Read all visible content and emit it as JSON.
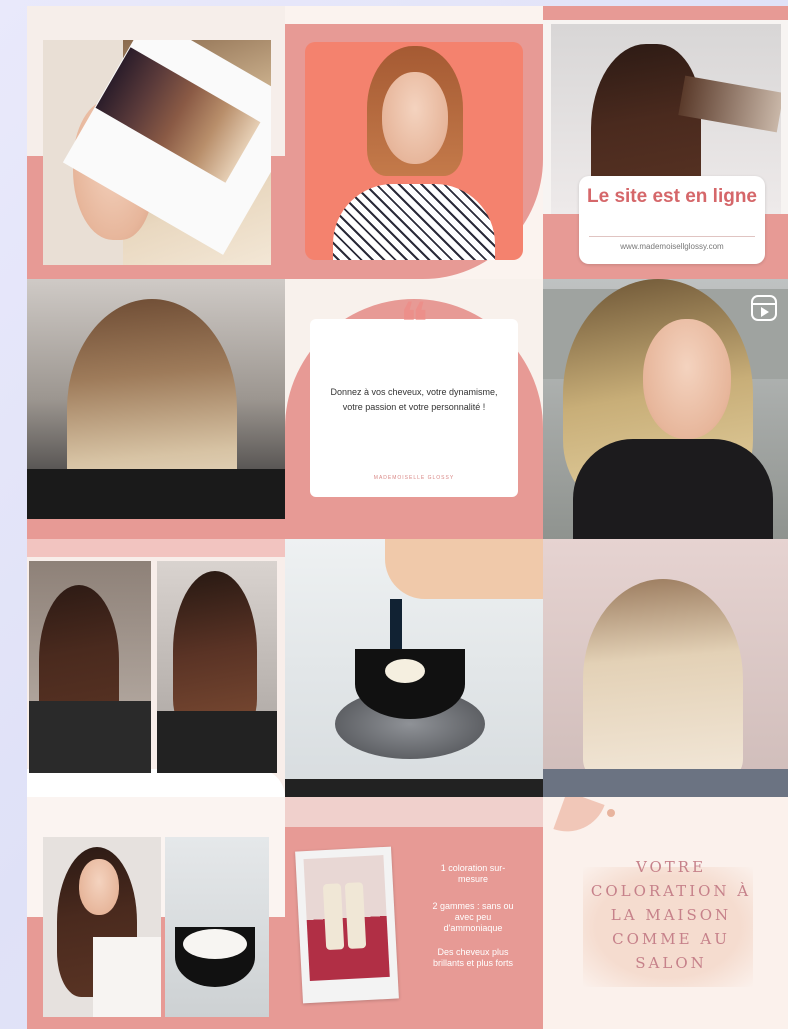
{
  "tiles": {
    "site_banner": {
      "title": "Le site est en ligne",
      "url": "www.mademoisellglossy.com"
    },
    "quote": {
      "mark": "❝",
      "text": "Donnez à vos cheveux, votre dynamisme, votre passion et votre personnalité !",
      "brand": "MADEMOISELLE GLOSSY"
    },
    "reel_icon": "reels-icon",
    "features": {
      "items": [
        "1 coloration sur-mesure",
        "2 gammes : sans ou avec peu d'ammoniaque",
        "Des cheveux plus brillants et plus forts"
      ]
    },
    "home_color": {
      "title": "VOTRE COLORATION À LA MAISON COMME AU SALON"
    }
  },
  "colors": {
    "pink": "#e79a95",
    "salmon": "#f08a78",
    "cream": "#f8f1ec",
    "accent_text": "#d5676a"
  }
}
